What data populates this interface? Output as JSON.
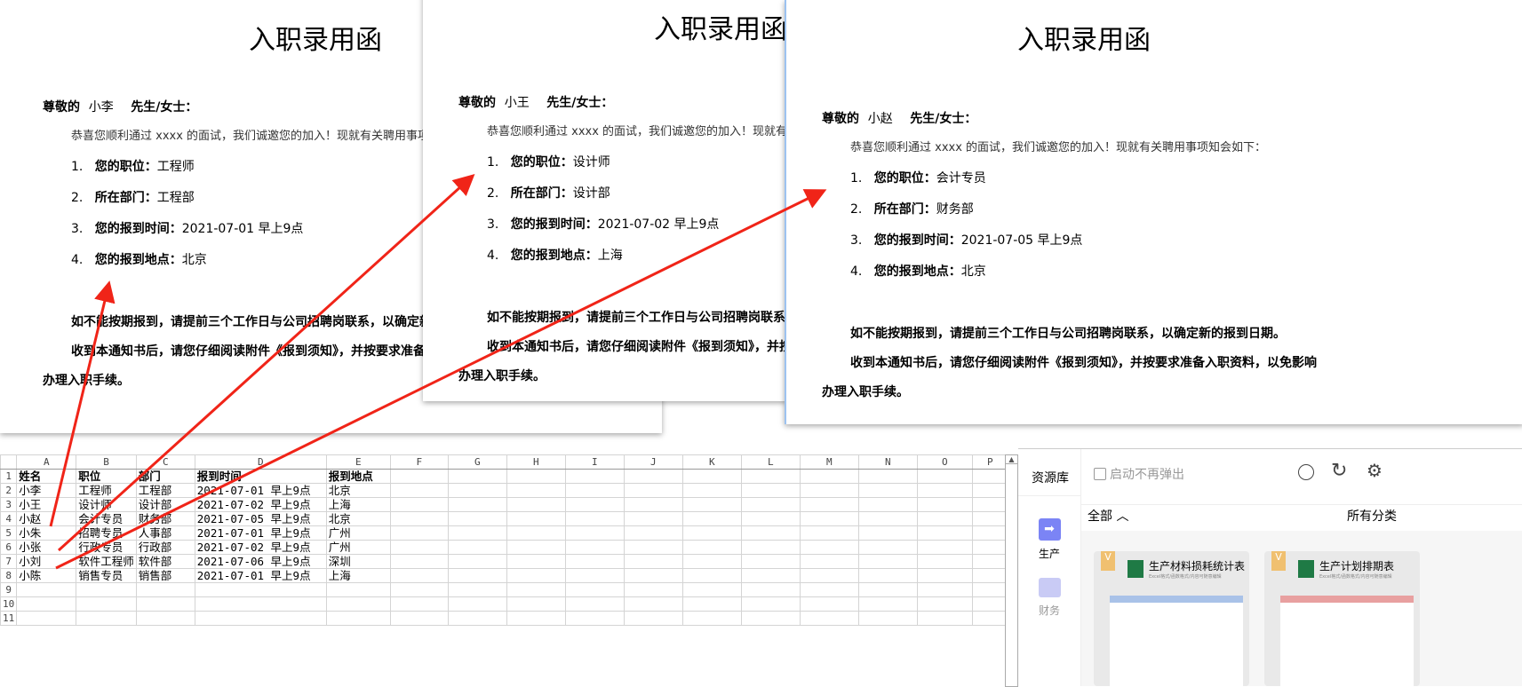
{
  "letters": [
    {
      "title": "入职录用函",
      "greeting_prefix": "尊敬的",
      "name": "小李",
      "greeting_suffix": "先生/女士：",
      "intro": "恭喜您顺利通过 xxxx 的面试，我们诚邀您的加入！现就有关聘用事项知会如下：",
      "items": [
        {
          "n": "1.",
          "label": "您的职位：",
          "value": "工程师"
        },
        {
          "n": "2.",
          "label": "所在部门：",
          "value": "工程部"
        },
        {
          "n": "3.",
          "label": "您的报到时间：",
          "value": "2021-07-01 早上9点"
        },
        {
          "n": "4.",
          "label": "您的报到地点：",
          "value": "北京"
        }
      ],
      "p1": "如不能按期报到，请提前三个工作日与公司招聘岗联系，以确定新的报到日期。",
      "p2": "收到本通知书后，请您仔细阅读附件《报到须知》，并按要求准备入职资料，以免影响",
      "p3": "办理入职手续。"
    },
    {
      "title": "入职录用函",
      "greeting_prefix": "尊敬的",
      "name": "小王",
      "greeting_suffix": "先生/女士：",
      "intro": "恭喜您顺利通过 xxxx 的面试，我们诚邀您的加入！现就有关聘用事项知会如下：",
      "items": [
        {
          "n": "1.",
          "label": "您的职位：",
          "value": "设计师"
        },
        {
          "n": "2.",
          "label": "所在部门：",
          "value": "设计部"
        },
        {
          "n": "3.",
          "label": "您的报到时间：",
          "value": "2021-07-02 早上9点"
        },
        {
          "n": "4.",
          "label": "您的报到地点：",
          "value": "上海"
        }
      ],
      "p1": "如不能按期报到，请提前三个工作日与公司招聘岗联系，以确定新的报到日期。",
      "p2": "收到本通知书后，请您仔细阅读附件《报到须知》，并按要求准备入职资料，以免影响",
      "p3": "办理入职手续。"
    },
    {
      "title": "入职录用函",
      "greeting_prefix": "尊敬的",
      "name": "小赵",
      "greeting_suffix": "先生/女士：",
      "intro": "恭喜您顺利通过 xxxx 的面试，我们诚邀您的加入！现就有关聘用事项知会如下：",
      "items": [
        {
          "n": "1.",
          "label": "您的职位：",
          "value": "会计专员"
        },
        {
          "n": "2.",
          "label": "所在部门：",
          "value": "财务部"
        },
        {
          "n": "3.",
          "label": "您的报到时间：",
          "value": "2021-07-05 早上9点"
        },
        {
          "n": "4.",
          "label": "您的报到地点：",
          "value": "北京"
        }
      ],
      "p1": "如不能按期报到，请提前三个工作日与公司招聘岗联系，以确定新的报到日期。",
      "p2": "收到本通知书后，请您仔细阅读附件《报到须知》，并按要求准备入职资料，以免影响",
      "p3": "办理入职手续。"
    }
  ],
  "sheet": {
    "columns": [
      "A",
      "B",
      "C",
      "D",
      "E",
      "F",
      "G",
      "H",
      "I",
      "J",
      "K",
      "L",
      "M",
      "N",
      "O",
      "P"
    ],
    "rows": [
      [
        "姓名",
        "职位",
        "部门",
        "报到时间",
        "报到地点"
      ],
      [
        "小李",
        "工程师",
        "工程部",
        "2021-07-01  早上9点",
        "北京"
      ],
      [
        "小王",
        "设计师",
        "设计部",
        "2021-07-02  早上9点",
        "上海"
      ],
      [
        "小赵",
        "会计专员",
        "财务部",
        "2021-07-05  早上9点",
        "北京"
      ],
      [
        "小朱",
        "招聘专员",
        "人事部",
        "2021-07-01  早上9点",
        "广州"
      ],
      [
        "小张",
        "行政专员",
        "行政部",
        "2021-07-02  早上9点",
        "广州"
      ],
      [
        "小刘",
        "软件工程师",
        "软件部",
        "2021-07-06  早上9点",
        "深圳"
      ],
      [
        "小陈",
        "销售专员",
        "销售部",
        "2021-07-01  早上9点",
        "上海"
      ],
      [],
      [],
      []
    ]
  },
  "panel": {
    "title": "资源库",
    "no_popup": "启动不再弹出",
    "filter": "全部",
    "category": "所有分类",
    "nav": [
      {
        "label": "生产",
        "color": "#7b84f5"
      },
      {
        "label": "财务",
        "color": "#c9cbf5"
      }
    ],
    "cards": [
      {
        "badge": "V",
        "title": "生产材料损耗统计表",
        "sub": "Excel格式/函数格式/内容可随意编辑"
      },
      {
        "badge": "V",
        "title": "生产计划排期表",
        "sub": "Excel格式/函数格式/内容可随意编辑"
      }
    ]
  },
  "arrow_color": "#f02418"
}
